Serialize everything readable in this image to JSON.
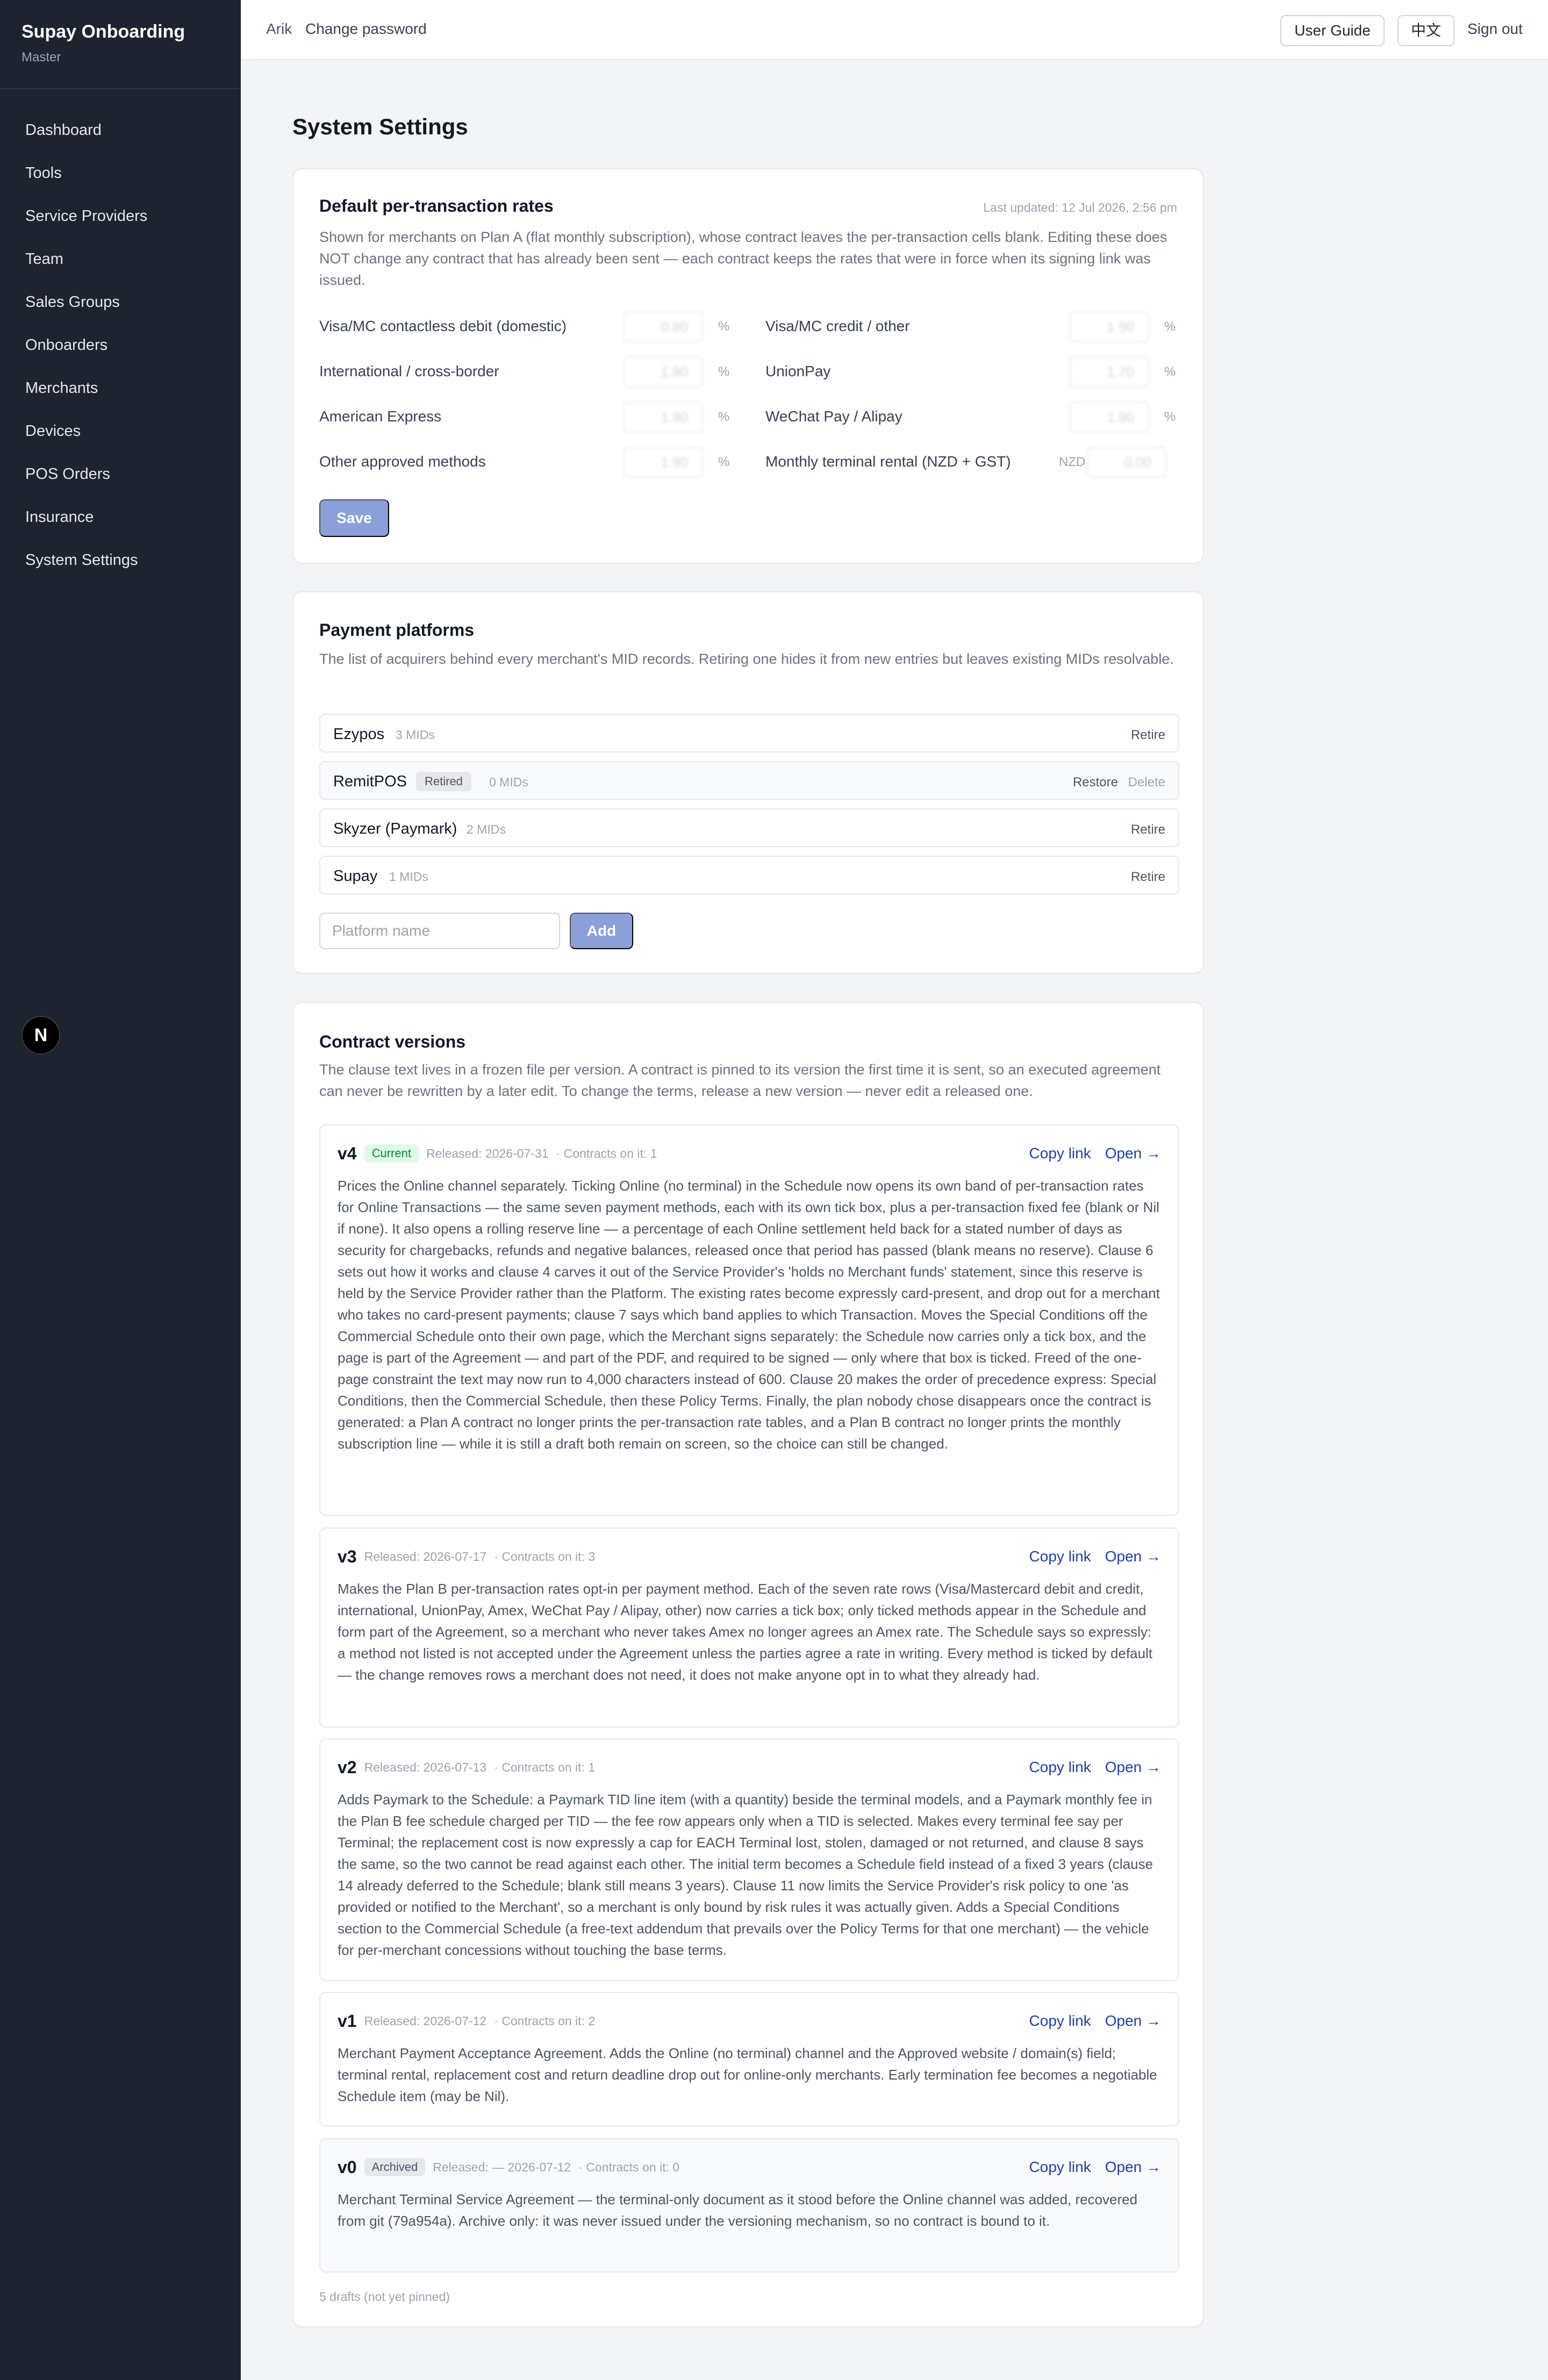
{
  "app": {
    "name": "Supay Onboarding",
    "role": "Master"
  },
  "nav": [
    {
      "label": "Dashboard"
    },
    {
      "label": "Tools"
    },
    {
      "label": "Service Providers"
    },
    {
      "label": "Team"
    },
    {
      "label": "Sales Groups"
    },
    {
      "label": "Onboarders"
    },
    {
      "label": "Merchants"
    },
    {
      "label": "Devices"
    },
    {
      "label": "POS Orders"
    },
    {
      "label": "Insurance"
    },
    {
      "label": "System Settings"
    }
  ],
  "topbar": {
    "user": "Arik",
    "change_password": "Change password",
    "user_guide": "User Guide",
    "language": "中文",
    "sign_out": "Sign out"
  },
  "page": {
    "title": "System Settings"
  },
  "rates": {
    "title": "Default per-transaction rates",
    "updated": "Last updated: 12 Jul 2026, 2:56 pm",
    "description": "Shown for merchants on Plan A (flat monthly subscription), whose contract leaves the per-transaction cells blank. Editing these does NOT change any contract that has already been sent — each contract keeps the rates that were in force when its signing link was issued.",
    "fields": [
      {
        "label": "Visa/MC contactless debit (domestic)",
        "value": "0.80",
        "unit": "%"
      },
      {
        "label": "Visa/MC credit / other",
        "value": "1.90",
        "unit": "%"
      },
      {
        "label": "International / cross-border",
        "value": "1.90",
        "unit": "%"
      },
      {
        "label": "UnionPay",
        "value": "1.70",
        "unit": "%"
      },
      {
        "label": "American Express",
        "value": "1.90",
        "unit": "%"
      },
      {
        "label": "WeChat Pay / Alipay",
        "value": "1.90",
        "unit": "%"
      },
      {
        "label": "Other approved methods",
        "value": "1.90",
        "unit": "%"
      },
      {
        "label": "Monthly terminal rental (NZD + GST)",
        "value": "0.00",
        "unit": "NZD"
      }
    ],
    "save_label": "Save"
  },
  "platforms": {
    "title": "Payment platforms",
    "description": "The list of acquirers behind every merchant's MID records. Retiring one hides it from new entries but leaves existing MIDs resolvable.",
    "items": [
      {
        "name": "Ezypos",
        "mids": "3 MIDs",
        "action": "Retire"
      },
      {
        "name": "RemitPOS",
        "badge": "Retired",
        "mids": "0 MIDs",
        "restore": "Restore",
        "delete": "Delete"
      },
      {
        "name": "Skyzer (Paymark)",
        "mids": "2 MIDs",
        "action": "Retire"
      },
      {
        "name": "Supay",
        "mids": "1 MIDs",
        "action": "Retire"
      }
    ],
    "placeholder": "Platform name",
    "add_label": "Add"
  },
  "contracts": {
    "title": "Contract versions",
    "description": "The clause text lives in a frozen file per version. A contract is pinned to its version the first time it is sent, so an executed agreement can never be rewritten by a later edit. To change the terms, release a new version — never edit a released one.",
    "copy_link": "Copy link",
    "open": "Open →",
    "versions": [
      {
        "version": "v4",
        "badge": "Current",
        "released": "Released: 2026-07-31",
        "contracts": "· Contracts on it: 1",
        "body": "Prices the Online channel separately. Ticking Online (no terminal) in the Schedule now opens its own band of per-transaction rates for Online Transactions — the same seven payment methods, each with its own tick box, plus a per-transaction fixed fee (blank or Nil if none). It also opens a rolling reserve line — a percentage of each Online settlement held back for a stated number of days as security for chargebacks, refunds and negative balances, released once that period has passed (blank means no reserve). Clause 6 sets out how it works and clause 4 carves it out of the Service Provider's 'holds no Merchant funds' statement, since this reserve is held by the Service Provider rather than the Platform. The existing rates become expressly card-present, and drop out for a merchant who takes no card-present payments; clause 7 says which band applies to which Transaction. Moves the Special Conditions off the Commercial Schedule onto their own page, which the Merchant signs separately: the Schedule now carries only a tick box, and the page is part of the Agreement — and part of the PDF, and required to be signed — only where that box is ticked. Freed of the one-page constraint the text may now run to 4,000 characters instead of 600. Clause 20 makes the order of precedence express: Special Conditions, then the Commercial Schedule, then these Policy Terms. Finally, the plan nobody chose disappears once the contract is generated: a Plan A contract no longer prints the per-transaction rate tables, and a Plan B contract no longer prints the monthly subscription line — while it is still a draft both remain on screen, so the choice can still be changed."
      },
      {
        "version": "v3",
        "badge": "",
        "released": "Released: 2026-07-17",
        "contracts": "· Contracts on it: 3",
        "body": "Makes the Plan B per-transaction rates opt-in per payment method. Each of the seven rate rows (Visa/Mastercard debit and credit, international, UnionPay, Amex, WeChat Pay / Alipay, other) now carries a tick box; only ticked methods appear in the Schedule and form part of the Agreement, so a merchant who never takes Amex no longer agrees an Amex rate. The Schedule says so expressly: a method not listed is not accepted under the Agreement unless the parties agree a rate in writing. Every method is ticked by default — the change removes rows a merchant does not need, it does not make anyone opt in to what they already had."
      },
      {
        "version": "v2",
        "badge": "",
        "released": "Released: 2026-07-13",
        "contracts": "· Contracts on it: 1",
        "body": "Adds Paymark to the Schedule: a Paymark TID line item (with a quantity) beside the terminal models, and a Paymark monthly fee in the Plan B fee schedule charged per TID — the fee row appears only when a TID is selected. Makes every terminal fee say per Terminal; the replacement cost is now expressly a cap for EACH Terminal lost, stolen, damaged or not returned, and clause 8 says the same, so the two cannot be read against each other. The initial term becomes a Schedule field instead of a fixed 3 years (clause 14 already deferred to the Schedule; blank still means 3 years). Clause 11 now limits the Service Provider's risk policy to one 'as provided or notified to the Merchant', so a merchant is only bound by risk rules it was actually given. Adds a Special Conditions section to the Commercial Schedule (a free-text addendum that prevails over the Policy Terms for that one merchant) — the vehicle for per-merchant concessions without touching the base terms."
      },
      {
        "version": "v1",
        "badge": "",
        "released": "Released: 2026-07-12",
        "contracts": "· Contracts on it: 2",
        "body": "Merchant Payment Acceptance Agreement. Adds the Online (no terminal) channel and the Approved website / domain(s) field; terminal rental, replacement cost and return deadline drop out for online-only merchants. Early termination fee becomes a negotiable Schedule item (may be Nil)."
      },
      {
        "version": "v0",
        "badge": "Archived",
        "released": "Released: — 2026-07-12",
        "contracts": "· Contracts on it: 0",
        "body": "Merchant Terminal Service Agreement — the terminal-only document as it stood before the Online channel was added, recovered from git (79a954a). Archive only: it was never issued under the versioning mechanism, so no contract is bound to it."
      }
    ],
    "drafts": "5 drafts (not yet pinned)"
  }
}
